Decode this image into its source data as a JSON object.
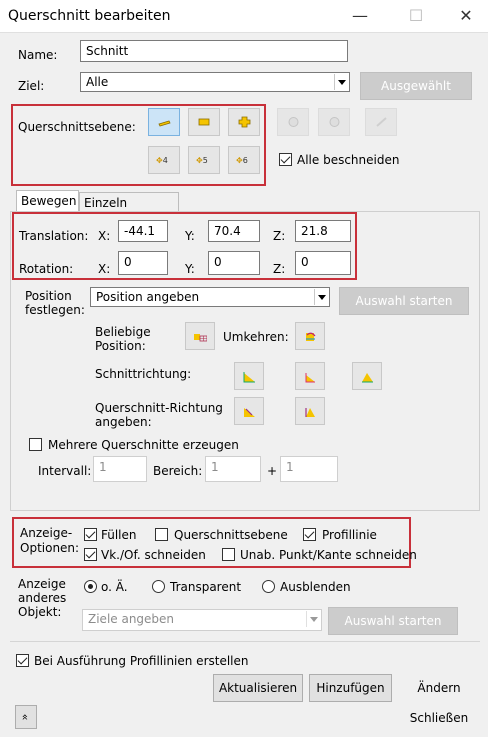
{
  "window": {
    "title": "Querschnitt bearbeiten",
    "minimize": "—",
    "maximize": "☐",
    "close": "✕"
  },
  "name": {
    "label": "Name:",
    "value": "Schnitt"
  },
  "ziel": {
    "label": "Ziel:",
    "value": "Alle",
    "button": "Ausgewählt"
  },
  "querschnittsebene": {
    "label": "Querschnittsebene:",
    "small_icons": [
      "4",
      "5",
      "6"
    ],
    "alle_beschneiden": {
      "label": "Alle beschneiden",
      "checked": true
    }
  },
  "tabs": [
    {
      "label": "Bewegen",
      "active": true
    },
    {
      "label": "Einzeln bewegen",
      "active": false
    }
  ],
  "translation": {
    "label": "Translation:",
    "x_label": "X:",
    "x": "-44.1",
    "y_label": "Y:",
    "y": "70.4",
    "z_label": "Z:",
    "z": "21.8"
  },
  "rotation": {
    "label": "Rotation:",
    "x_label": "X:",
    "x": "0",
    "y_label": "Y:",
    "y": "0",
    "z_label": "Z:",
    "z": "0"
  },
  "position": {
    "label_line1": "Position",
    "label_line2": "festlegen:",
    "value": "Position angeben",
    "button": "Auswahl starten",
    "beliebige_line1": "Beliebige",
    "beliebige_line2": "Position:",
    "umkehren": "Umkehren:",
    "schnittrichtung": "Schnittrichtung:",
    "qr_line1": "Querschnitt-Richtung",
    "qr_line2": "angeben:"
  },
  "mehrere": {
    "label": "Mehrere Querschnitte erzeugen",
    "checked": false,
    "intervall_label": "Intervall:",
    "intervall": "1",
    "bereich_label": "Bereich: -",
    "bereich_von": "1",
    "plus": "+",
    "bereich_bis": "1"
  },
  "anzeige_optionen": {
    "label_line1": "Anzeige-",
    "label_line2": "Optionen:",
    "fuellen": {
      "label": "Füllen",
      "checked": true
    },
    "querschnittsebene": {
      "label": "Querschnittsebene",
      "checked": false
    },
    "profillinie": {
      "label": "Profillinie",
      "checked": true
    },
    "vk_of": {
      "label": "Vk./Of. schneiden",
      "checked": true
    },
    "unab": {
      "label": "Unab. Punkt/Kante schneiden",
      "checked": false
    }
  },
  "anzeige_anderes": {
    "label_line1": "Anzeige",
    "label_line2": "anderes",
    "label_line3": "Objekt:",
    "oae": "o. Ä.",
    "transparent": "Transparent",
    "ausblenden": "Ausblenden",
    "selected": "oae",
    "ziele": "Ziele angeben",
    "button": "Auswahl starten"
  },
  "profillinien": {
    "label": "Bei Ausführung Profillinien erstellen",
    "checked": true
  },
  "buttons": {
    "aktualisieren": "Aktualisieren",
    "hinzufuegen": "Hinzufügen",
    "aendern": "Ändern",
    "schliessen": "Schließen",
    "collapse": "»"
  },
  "colors": {
    "highlight_red": "#c8303a",
    "selected_blue": "#cce4f7",
    "icon_yellow": "#f5c400"
  }
}
